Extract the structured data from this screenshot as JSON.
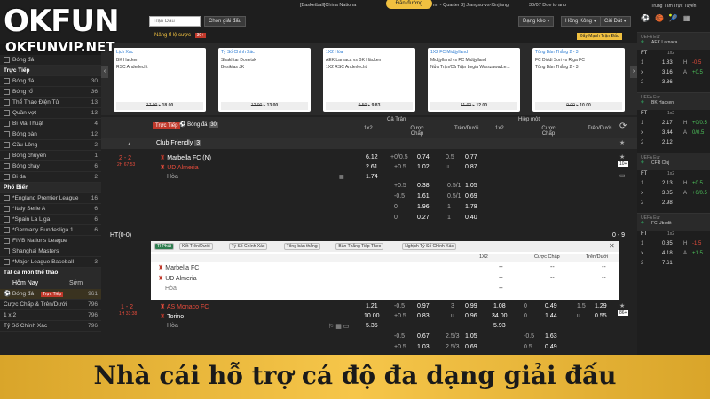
{
  "logo": {
    "main": "OKFUN",
    "sub": "OKFUNVIP.NET"
  },
  "top": {
    "search_placeholder": "Trận Đấu",
    "search_btn": "Chọn giải đấu",
    "breadcrumb": "[Basketball]China Nationa",
    "status_btn": "Đăn đường",
    "breadcrumb2": "ım - Quarter 3] Jiangsu-vs-Xinjiang",
    "date": "30/07 Due to ano",
    "dropdown1": "Dạng kèo",
    "dropdown2": "Hồng Kông",
    "dropdown3": "Cài Đặt",
    "promo": "Nâng tỉ lệ cược",
    "promo_badge": "30+",
    "boost": "Đẩy Mạnh Trận Đấu"
  },
  "sidebar": {
    "items": [
      {
        "label": "Bóng đá",
        "count": ""
      },
      {
        "label": "Trực Tiếp",
        "count": "",
        "head": true
      },
      {
        "label": "Bóng đá",
        "count": "30"
      },
      {
        "label": "Bóng rổ",
        "count": "36"
      },
      {
        "label": "Thể Thao Điện Tử",
        "count": "13"
      },
      {
        "label": "Quần vợt",
        "count": "13"
      },
      {
        "label": "Bi Ma Thuật",
        "count": "4"
      },
      {
        "label": "Bóng bàn",
        "count": "12"
      },
      {
        "label": "Cầu Lông",
        "count": "2"
      },
      {
        "label": "Bóng chuyền",
        "count": "1"
      },
      {
        "label": "Bóng chày",
        "count": "6"
      },
      {
        "label": "Bi da",
        "count": "2"
      },
      {
        "label": "Phổ Biến",
        "count": "",
        "head": true
      },
      {
        "label": "*England Premier League",
        "count": "16"
      },
      {
        "label": "*Italy Serie A",
        "count": "6"
      },
      {
        "label": "*Spain La Liga",
        "count": "6"
      },
      {
        "label": "*Germany Bundesliga 1",
        "count": "6"
      },
      {
        "label": "FIVB Nations League",
        "count": ""
      },
      {
        "label": "Shanghai Masters",
        "count": ""
      },
      {
        "label": "*Major League Baseball",
        "count": "3"
      },
      {
        "label": "Tất cả môn thể thao",
        "count": "",
        "head": true
      }
    ],
    "tab_today": "Hôm Nay",
    "tab_early": "Sớm",
    "sel_sport": "Bóng đá",
    "sel_badge": "Trực Tiếp",
    "sel_count": "961",
    "sub1": "Cược Chấp & Trên/Dưới",
    "sub1_c": "796",
    "sub2": "1 x 2",
    "sub2_c": "796",
    "sub3": "Tỷ Số Chính Xác",
    "sub3_c": "796"
  },
  "cards": [
    {
      "title": "Lịch Xác",
      "row1": "BK Hacken",
      "row2": "RSC Anderlecht",
      "odd1": "17.00",
      "odd2": "18.00"
    },
    {
      "title": "Tỷ Số Chính Xác",
      "row1": "Shakhtar Donetsk",
      "row2": "Besiktas JK",
      "odd1": "12.00",
      "odd2": "13.00"
    },
    {
      "title": "1X2 Hòa",
      "row1": "AEK Larnaca vs BK Häcken",
      "row2": "1X2 RSC Anderlecht",
      "odd1": "9.50",
      "odd2": "9.83"
    },
    {
      "title": "1X2 FC Midtjylland",
      "row1": "Midtjylland vs FC Midtjylland",
      "row2": "Nửa Trận/Cả Trận Legia Warszawa/Le...",
      "odd1": "11.00",
      "odd2": "12.00"
    },
    {
      "title": "Tổng Bàn Thắng 2 - 3",
      "row1": "FC Diddi Sori vs Riga FC",
      "row2": "Tổng Bàn Thắng 2 - 3",
      "odd1": "9.00",
      "odd2": "10.00"
    }
  ],
  "live": {
    "label": "Trực Tiếp",
    "sport": "Bóng đá",
    "count": "30"
  },
  "cols": {
    "full": "Cả Trận",
    "half": "Hiệp một",
    "x12": "1x2",
    "hdp": "Cược Chấp",
    "ou": "Trên/Dưới"
  },
  "league": "Club Friendly",
  "league_count": "3",
  "m1": {
    "score": "2 - 2",
    "time": "2H 67:53",
    "home": "Marbella FC (N)",
    "away": "UD Almeria",
    "draw": "Hòa",
    "x1": "6.12",
    "x2": "2.61",
    "x3": "1.74",
    "h1": "+0/0.5",
    "h1o": "0.74",
    "h2": "+0.5",
    "h2o": "1.02",
    "o1": "0.5",
    "o1o": "0.77",
    "o2": "u",
    "o2o": "0.87",
    "more": "10+"
  },
  "extra_rows": [
    {
      "a": "+0.5",
      "b": "0.38",
      "c": "0.5/1",
      "d": "1.05"
    },
    {
      "a": "-0.5",
      "b": "1.61",
      "c": "0.5/1",
      "d": "0.69"
    },
    {
      "a": "0",
      "b": "1.96",
      "c": "1",
      "d": "1.78"
    },
    {
      "a": "0",
      "b": "0.27",
      "c": "1",
      "d": "0.40"
    }
  ],
  "ht": {
    "label": "HT(0-0)",
    "score": "0 - 9"
  },
  "sub": {
    "tabs": [
      "Tỉ Phút",
      "Kết Trên/Dưới",
      "Tỷ Số Chính Xác",
      "Tổng bàn thắng",
      "Bàn Thắng Tiếp Theo",
      "Nghịch Tỷ Số Chính Xác"
    ],
    "cols": [
      "1X2",
      "Cược Chấp",
      "Trên/Dưới"
    ],
    "home": "Marbella FC",
    "away": "UD Almeria",
    "draw": "Hòa",
    "dash": "--"
  },
  "m2": {
    "score": "1 - 2",
    "time": "1H 33:38",
    "home": "AS Monaco FC",
    "away": "Torino",
    "draw": "Hòa",
    "x1": "1.21",
    "x2": "10.00",
    "x3": "5.35",
    "h1": "-0.5",
    "h1o": "0.97",
    "h2": "+0.5",
    "h2o": "0.83",
    "o1": "3",
    "o1o": "0.99",
    "o2": "u",
    "o2o": "0.96",
    "hx1": "1.08",
    "hx2": "34.00",
    "hx3": "5.93",
    "hh1": "0",
    "hh1o": "0.49",
    "hh2": "0",
    "hh2o": "1.44",
    "ho1": "1.5",
    "ho1o": "1.29",
    "ho2": "u",
    "ho2o": "0.55",
    "more": "86+"
  },
  "m2_extra": [
    {
      "a": "-0.5",
      "b": "0.67",
      "c": "2.5/3",
      "d": "1.05",
      "e": "-0.5",
      "f": "1.63"
    },
    {
      "a": "+0.5",
      "b": "1.03",
      "c": "2.5/3",
      "d": "0.69",
      "e": "0.5",
      "f": "0.49"
    }
  ],
  "right": {
    "title": "Trung Tâm Trực Tuyến",
    "teams": [
      {
        "league": "UEFA Eur",
        "name": "AEK Larnaca",
        "ft": "FT",
        "x": "1x2",
        "rows": [
          [
            "1",
            "1.83",
            "H",
            "-0.5"
          ],
          [
            "x",
            "3.16",
            "A",
            "+0.5"
          ],
          [
            "2",
            "3.86",
            "",
            ""
          ]
        ]
      },
      {
        "league": "UEFA Eur",
        "name": "BK Hacken",
        "ft": "FT",
        "x": "1x2",
        "rows": [
          [
            "1",
            "2.17",
            "H",
            "+0/0.5"
          ],
          [
            "x",
            "3.44",
            "A",
            "0/0.5"
          ],
          [
            "2",
            "2.12",
            "",
            ""
          ]
        ]
      },
      {
        "league": "UEFA Eur",
        "name": "CFR Cluj",
        "ft": "FT",
        "x": "1x2",
        "rows": [
          [
            "1",
            "2.13",
            "H",
            "+0.5"
          ],
          [
            "x",
            "3.05",
            "A",
            "+0/0.5"
          ],
          [
            "2",
            "2.98",
            "",
            ""
          ]
        ]
      },
      {
        "league": "UEFA Eur",
        "name": "FC Ubedit",
        "ft": "FT",
        "x": "1x2",
        "rows": [
          [
            "1",
            "0.85",
            "H",
            "-1.5"
          ],
          [
            "x",
            "4.18",
            "A",
            "+1.5"
          ],
          [
            "2",
            "7.61",
            "",
            ""
          ]
        ]
      }
    ]
  },
  "banner": "Nhà cái hỗ trợ cá độ đa dạng giải đấu"
}
